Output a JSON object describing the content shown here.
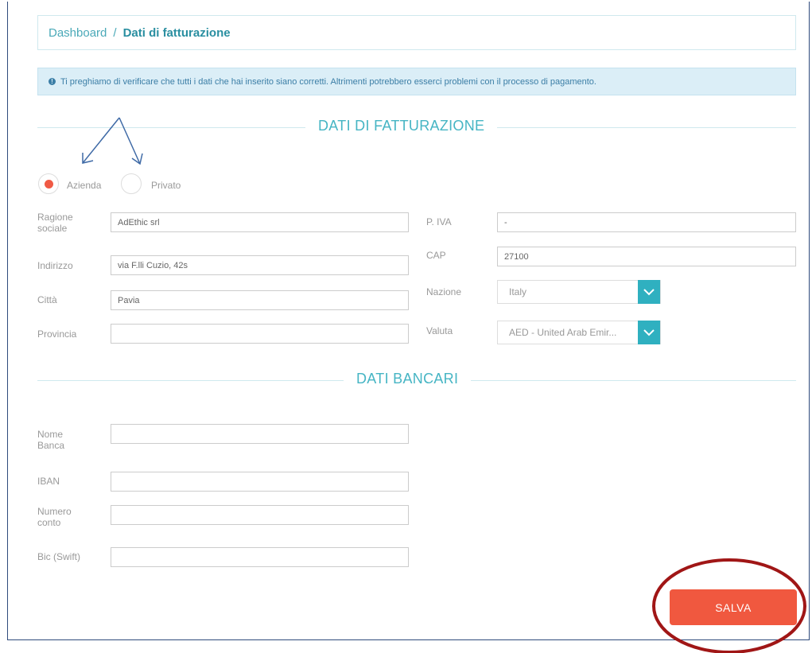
{
  "breadcrumb": {
    "home": "Dashboard",
    "separator": "/",
    "current": "Dati di fatturazione"
  },
  "alert": {
    "icon": "info-icon",
    "text": "Ti preghiamo di verificare che tutti i dati che hai inserito siano corretti. Altrimenti potrebbero esserci problemi con il processo di pagamento."
  },
  "billing": {
    "title": "DATI DI FATTURAZIONE",
    "type_options": [
      {
        "label": "Azienda",
        "checked": true
      },
      {
        "label": "Privato",
        "checked": false
      }
    ],
    "left_fields": [
      {
        "label": "Ragione sociale",
        "value": "AdEthic srl"
      },
      {
        "label": "Indirizzo",
        "value": "via F.lli Cuzio, 42s"
      },
      {
        "label": "Città",
        "value": "Pavia"
      },
      {
        "label": "Provincia",
        "value": ""
      }
    ],
    "right_fields": {
      "piva": {
        "label": "P. IVA",
        "value": "-"
      },
      "cap": {
        "label": "CAP",
        "value": "27100"
      },
      "nazione": {
        "label": "Nazione",
        "selected": "Italy"
      },
      "valuta": {
        "label": "Valuta",
        "selected": "AED - United Arab Emir..."
      }
    }
  },
  "bank": {
    "title": "DATI BANCARI",
    "fields": [
      {
        "label": "Nome Banca",
        "value": ""
      },
      {
        "label": "IBAN",
        "value": ""
      },
      {
        "label": "Numero conto",
        "value": ""
      },
      {
        "label": "Bic (Swift)",
        "value": ""
      }
    ]
  },
  "actions": {
    "save_label": "SALVA"
  },
  "colors": {
    "accent": "#46b5c4",
    "button": "#f0583f",
    "annotation_arrows": "#3f6aa6",
    "annotation_circle": "#a01616"
  }
}
